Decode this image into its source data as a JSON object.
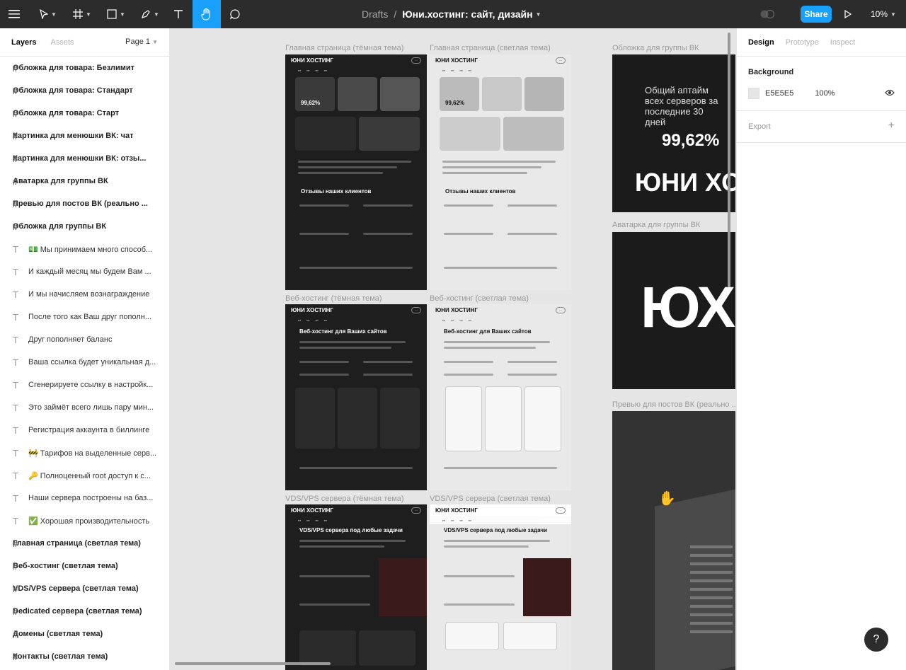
{
  "toolbar": {
    "breadcrumb_root": "Drafts",
    "breadcrumb_sep": "/",
    "file_name": "Юни.хостинг: сайт, дизайн",
    "share_label": "Share",
    "zoom": "10%"
  },
  "left_panel": {
    "tabs": [
      "Layers",
      "Assets"
    ],
    "page": "Page 1",
    "layers": [
      {
        "type": "frame",
        "name": "Обложка для товара: Безлимит"
      },
      {
        "type": "frame",
        "name": "Обложка для товара: Стандарт"
      },
      {
        "type": "frame",
        "name": "Обложка для товара: Старт"
      },
      {
        "type": "frame",
        "name": "Картинка для менюшки ВК: чат"
      },
      {
        "type": "frame",
        "name": "Картинка для менюшки ВК: отзы..."
      },
      {
        "type": "frame",
        "name": "Аватарка для группы ВК"
      },
      {
        "type": "frame",
        "name": "Превью для постов ВК (реально ..."
      },
      {
        "type": "frame",
        "name": "Обложка для группы ВК"
      },
      {
        "type": "text",
        "name": "💵 Мы принимаем много способ..."
      },
      {
        "type": "text",
        "name": "И каждый месяц мы будем Вам ..."
      },
      {
        "type": "text",
        "name": "И мы начисляем вознаграждение"
      },
      {
        "type": "text",
        "name": "После того как Ваш друг пополн..."
      },
      {
        "type": "text",
        "name": "Друг пополняет баланс"
      },
      {
        "type": "text",
        "name": "Ваша ссылка будет уникальная д..."
      },
      {
        "type": "text",
        "name": "Сгенерируете ссылку в настройк..."
      },
      {
        "type": "text",
        "name": "Это займёт всего лишь пару мин..."
      },
      {
        "type": "text",
        "name": "Регистрация аккаунта в биллинге"
      },
      {
        "type": "text",
        "name": "🚧 Тарифов на выделенные серв..."
      },
      {
        "type": "text",
        "name": "🔑 Полноценный root доступ к с..."
      },
      {
        "type": "text",
        "name": "Наши сервера построены на баз..."
      },
      {
        "type": "text",
        "name": "✅ Хорошая производительность"
      },
      {
        "type": "frame",
        "name": "Главная страница (светлая тема)"
      },
      {
        "type": "frame",
        "name": "Веб-хостинг (светлая тема)"
      },
      {
        "type": "frame",
        "name": "VDS/VPS сервера (светлая тема)"
      },
      {
        "type": "frame",
        "name": "Dedicated сервера (светлая тема)"
      },
      {
        "type": "frame",
        "name": "Домены (светлая тема)"
      },
      {
        "type": "frame",
        "name": "Контакты (светлая тема)"
      }
    ]
  },
  "canvas": {
    "labels": {
      "home_dark": "Главная страница (тёмная тема)",
      "home_light": "Главная страница (светлая тема)",
      "vk_cover": "Обложка для группы ВК",
      "vk_avatar": "Аватарка для группы ВК",
      "vk_preview": "Превью для постов ВК (реально ...",
      "web_dark": "Веб-хостинг (тёмная тема)",
      "web_light": "Веб-хостинг (светлая тема)",
      "vds_dark": "VDS/VPS сервера (тёмная тема)",
      "vds_light": "VDS/VPS сервера (светлая тема)"
    },
    "brand": "ЮНИ ХОСТИНГ",
    "home_uptime": "99,62%",
    "home_reviews": "Отзывы наших клиентов",
    "web_title": "Веб-хостинг для Ваших сайтов",
    "vds_title": "VDS/VPS сервера под любые задачи",
    "cover_text": "Общий аптайм всех серверов за последние 30 дней",
    "cover_value": "99,62%",
    "cover_brand": "ЮНИ ХО",
    "avatar_text": "ЮХ"
  },
  "right_panel": {
    "tabs": [
      "Design",
      "Prototype",
      "Inspect"
    ],
    "background_title": "Background",
    "bg_hex": "E5E5E5",
    "bg_opacity": "100%",
    "export_title": "Export"
  },
  "colors": {
    "accent": "#18a0fb",
    "toolbar": "#2c2c2c",
    "canvas": "#e5e5e5"
  }
}
